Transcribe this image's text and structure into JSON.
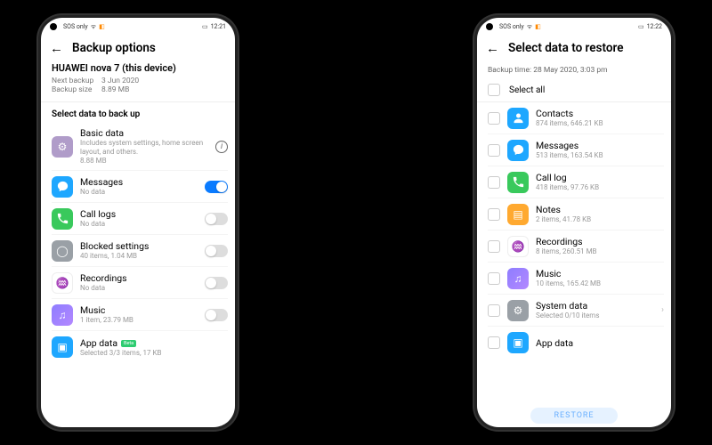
{
  "status": {
    "carrier": "SOS only",
    "time_left": "12:21",
    "time_right": "12:22"
  },
  "left": {
    "title": "Backup options",
    "device_name": "HUAWEI nova 7 (this device)",
    "next_backup_label": "Next backup",
    "next_backup_value": "3 Jun 2020",
    "backup_size_label": "Backup size",
    "backup_size_value": "8.89 MB",
    "section": "Select data to back up",
    "basic": {
      "title": "Basic data",
      "sub": "Includes system settings, home screen layout, and others.",
      "size": "8.88 MB"
    },
    "messages": {
      "title": "Messages",
      "sub": "No data"
    },
    "calllogs": {
      "title": "Call logs",
      "sub": "No data"
    },
    "blocked": {
      "title": "Blocked settings",
      "sub": "40 items, 1.04 MB"
    },
    "recordings": {
      "title": "Recordings",
      "sub": "No data"
    },
    "music": {
      "title": "Music",
      "sub": "1 item, 23.79 MB"
    },
    "appdata": {
      "title": "App data",
      "badge": "Beta",
      "sub": "Selected 3/3 items, 17 KB"
    }
  },
  "right": {
    "title": "Select data to restore",
    "backup_time": "Backup time: 28 May 2020, 3:03 pm",
    "select_all": "Select all",
    "contacts": {
      "title": "Contacts",
      "sub": "874 items, 646.21 KB"
    },
    "messages": {
      "title": "Messages",
      "sub": "513 items, 163.54 KB"
    },
    "calllog": {
      "title": "Call log",
      "sub": "418 items, 97.76 KB"
    },
    "notes": {
      "title": "Notes",
      "sub": "2 items, 41.78 KB"
    },
    "recordings": {
      "title": "Recordings",
      "sub": "8 items, 260.51 MB"
    },
    "music": {
      "title": "Music",
      "sub": "10 items, 165.42 MB"
    },
    "systemdata": {
      "title": "System data",
      "sub": "Selected 0/10 items"
    },
    "appdata": {
      "title": "App data"
    },
    "restore": "RESTORE"
  }
}
